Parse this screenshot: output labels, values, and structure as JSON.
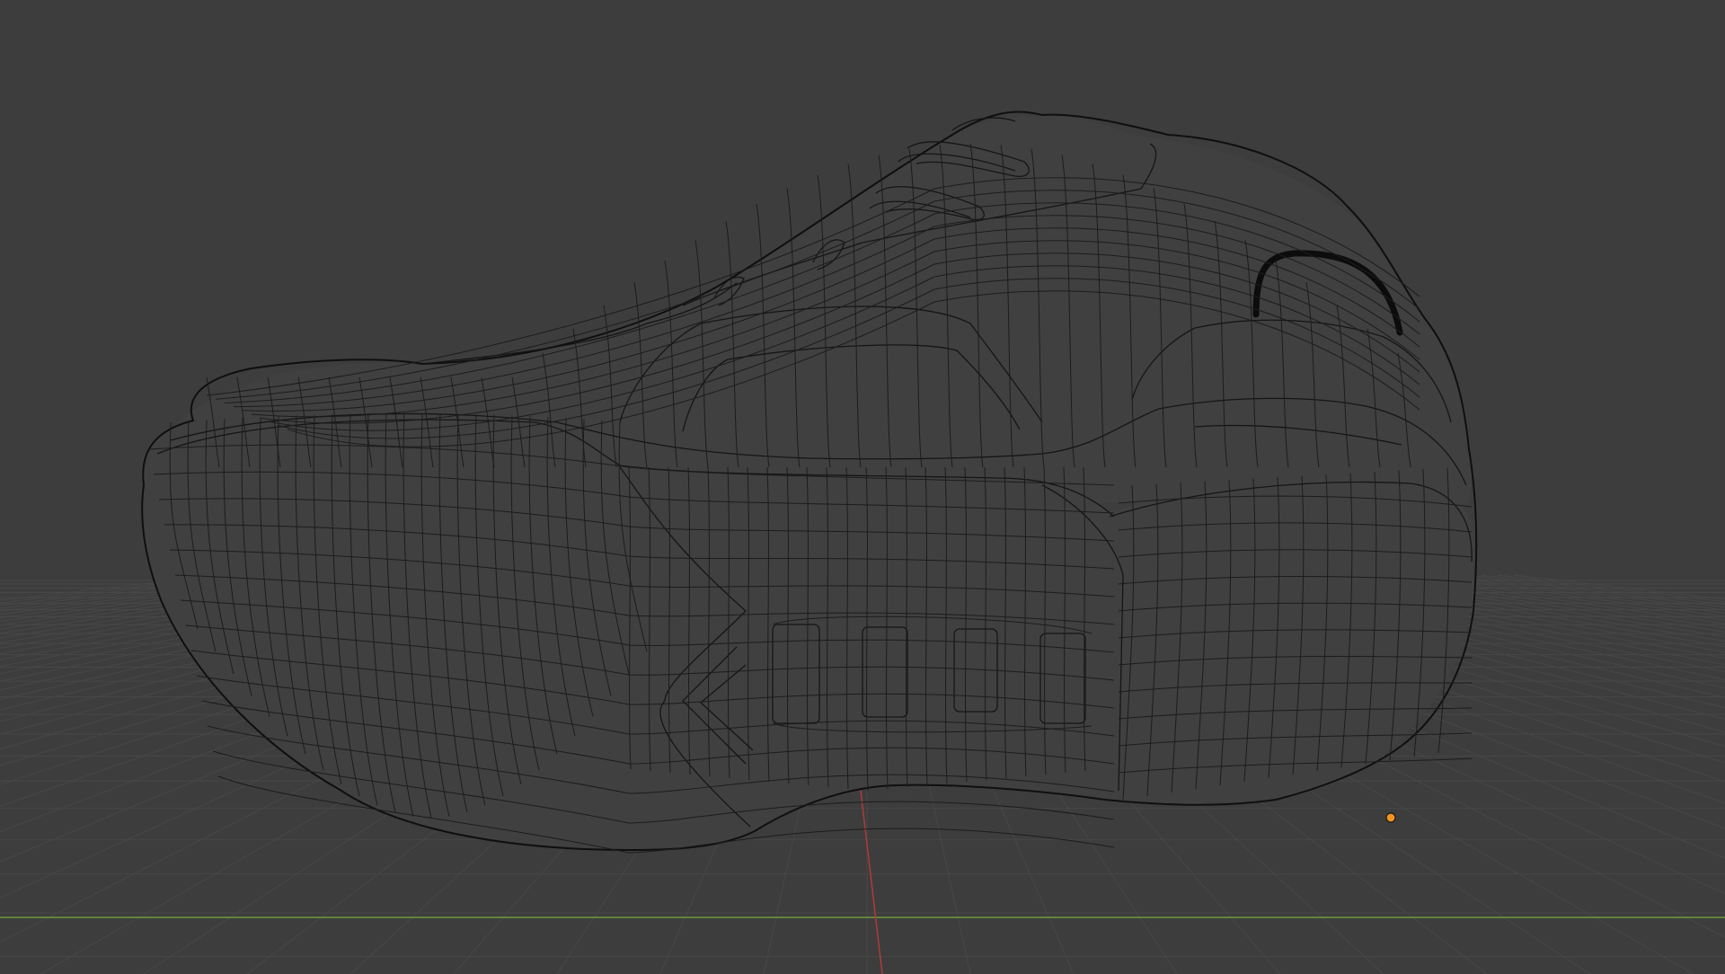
{
  "viewport": {
    "background": "#3d3d3d",
    "grid_color": "#474747",
    "x_axis_color": "#6f9a3d",
    "y_axis_color": "#b03a3a",
    "mesh_wire_color": "#151515",
    "mesh_face_color": "#404040",
    "origin_color": "#f0951f",
    "view_mode": "wireframe-overlay",
    "show_grid": true
  }
}
